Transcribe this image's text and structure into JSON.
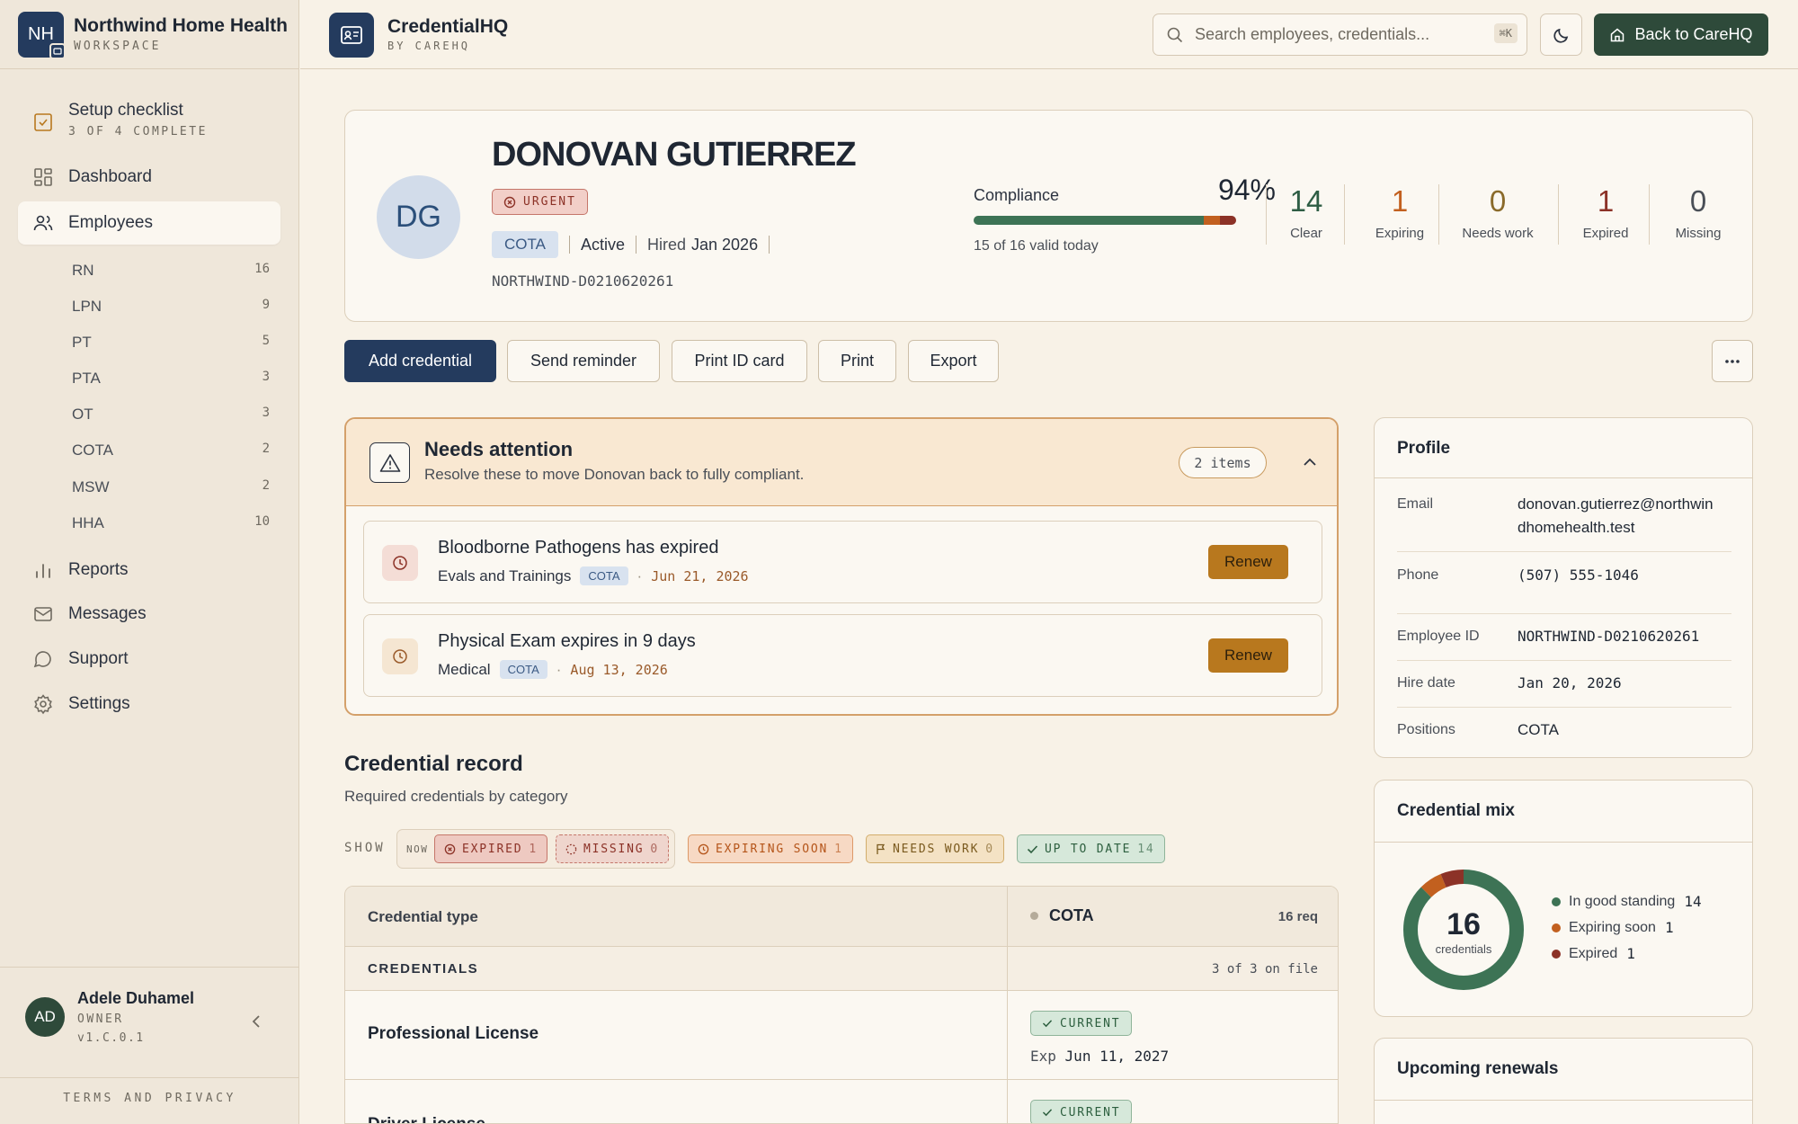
{
  "workspace": {
    "initials": "NH",
    "name": "Northwind Home Health",
    "sub": "WORKSPACE"
  },
  "sidebar": {
    "setup": {
      "title": "Setup checklist",
      "progress": "3 OF 4 COMPLETE"
    },
    "nav": [
      {
        "label": "Dashboard",
        "icon": "dashboard-icon"
      },
      {
        "label": "Employees",
        "icon": "users-icon",
        "active": true
      },
      {
        "label": "Reports",
        "icon": "bar-chart-icon"
      },
      {
        "label": "Messages",
        "icon": "mail-icon"
      },
      {
        "label": "Support",
        "icon": "chat-bubble-icon"
      },
      {
        "label": "Settings",
        "icon": "gear-icon"
      }
    ],
    "positions": [
      {
        "label": "RN",
        "count": "16"
      },
      {
        "label": "LPN",
        "count": "9"
      },
      {
        "label": "PT",
        "count": "5"
      },
      {
        "label": "PTA",
        "count": "3"
      },
      {
        "label": "OT",
        "count": "3"
      },
      {
        "label": "COTA",
        "count": "2"
      },
      {
        "label": "MSW",
        "count": "2"
      },
      {
        "label": "HHA",
        "count": "10"
      }
    ],
    "user": {
      "initials": "AD",
      "name": "Adele Duhamel",
      "role": "OWNER",
      "version": "v1.C.0.1"
    },
    "terms": "TERMS AND PRIVACY"
  },
  "topbar": {
    "app_name": "CredentialHQ",
    "app_sub": "BY CAREHQ",
    "search_placeholder": "Search employees, credentials...",
    "search_shortcut": "⌘K",
    "back_label": "Back to CareHQ"
  },
  "employee": {
    "initials": "DG",
    "name": "DONOVAN GUTIERREZ",
    "urgency": "URGENT",
    "position": "COTA",
    "status": "Active",
    "hired_label": "Hired",
    "hired_value": "Jan 2026",
    "id": "NORTHWIND-D0210620261",
    "compliance_label": "Compliance",
    "compliance_pct": "94%",
    "compliance_sub": "15 of 16 valid today",
    "compliance_bar": {
      "valid": 14,
      "expiring": 1,
      "expired": 1,
      "total": 16
    },
    "stats": [
      {
        "value": "14",
        "label": "Clear",
        "color": "#2e5d44"
      },
      {
        "value": "1",
        "label": "Expiring",
        "color": "#c2601f"
      },
      {
        "value": "0",
        "label": "Needs work",
        "color": "#8a6a2a"
      },
      {
        "value": "1",
        "label": "Expired",
        "color": "#8c3227"
      },
      {
        "value": "0",
        "label": "Missing",
        "color": "#4a4f57"
      }
    ]
  },
  "actions": {
    "add": "Add credential",
    "remind": "Send reminder",
    "print_id": "Print ID card",
    "print": "Print",
    "export": "Export"
  },
  "attention": {
    "title": "Needs attention",
    "subtitle": "Resolve these to move Donovan back to fully compliant.",
    "count": "2 items",
    "items": [
      {
        "title": "Bloodborne Pathogens has expired",
        "category": "Evals and Trainings",
        "chip": "COTA",
        "date": "Jun 21, 2026",
        "action": "Renew"
      },
      {
        "title": "Physical Exam expires in 9 days",
        "category": "Medical",
        "chip": "COTA",
        "date": "Aug 13, 2026",
        "action": "Renew"
      }
    ]
  },
  "record": {
    "title": "Credential record",
    "subtitle": "Required credentials by category",
    "show_label": "SHOW",
    "now_label": "NOW",
    "filters": [
      {
        "label": "EXPIRED",
        "count": "1"
      },
      {
        "label": "MISSING",
        "count": "0"
      },
      {
        "label": "EXPIRING SOON",
        "count": "1"
      },
      {
        "label": "NEEDS WORK",
        "count": "0"
      },
      {
        "label": "UP TO DATE",
        "count": "14"
      }
    ],
    "table": {
      "col_type": "Credential type",
      "col_position": "COTA",
      "col_req": "16 req",
      "group": "CREDENTIALS",
      "group_count": "3 of 3 on file",
      "rows": [
        {
          "name": "Professional License",
          "status": "CURRENT",
          "exp_label": "Exp",
          "exp_date": "Jun 11, 2027"
        },
        {
          "name": "Driver License",
          "status": "CURRENT"
        }
      ]
    }
  },
  "profile": {
    "title": "Profile",
    "fields": [
      {
        "label": "Email",
        "value": "donovan.gutierrez@northwindhomehealth.test",
        "line1": "donovan.gutierrez@northwin",
        "line2": "dhomehealth.test"
      },
      {
        "label": "Phone",
        "value": "(507) 555-1046"
      },
      {
        "label": "Employee ID",
        "value": "NORTHWIND-D0210620261"
      },
      {
        "label": "Hire date",
        "value": "Jan 20, 2026"
      },
      {
        "label": "Positions",
        "value": "COTA"
      }
    ]
  },
  "mix": {
    "title": "Credential mix",
    "total": "16",
    "total_label": "credentials",
    "segments": [
      {
        "label": "In good standing",
        "value": 14,
        "color": "#3d7355"
      },
      {
        "label": "Expiring soon",
        "value": 1,
        "color": "#c2601f"
      },
      {
        "label": "Expired",
        "value": 1,
        "color": "#8c3227"
      }
    ]
  },
  "renewals": {
    "title": "Upcoming renewals"
  }
}
